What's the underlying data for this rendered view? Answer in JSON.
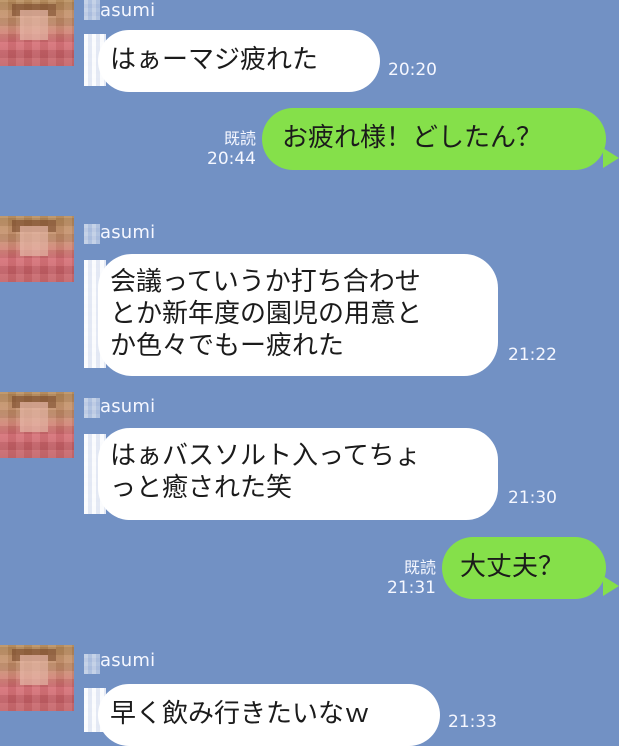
{
  "chat": {
    "messages": [
      {
        "type": "incoming",
        "sender": "asumi",
        "text": "はぁーマジ疲れた",
        "time": "20:20"
      },
      {
        "type": "outgoing",
        "read": "既読",
        "time": "20:44",
        "text": "お疲れ様！どしたん？"
      },
      {
        "type": "incoming",
        "sender": "asumi",
        "text": "会議っていうか打ち合わせ\nとか新年度の園児の用意と\nか色々でもー疲れた",
        "time": "21:22"
      },
      {
        "type": "incoming",
        "sender": "asumi",
        "text": "はぁバスソルト入ってちょ\nっと癒された笑",
        "time": "21:30"
      },
      {
        "type": "outgoing",
        "read": "既読",
        "time": "21:31",
        "text": "大丈夫？"
      },
      {
        "type": "incoming",
        "sender": "asumi",
        "text": "早く飲み行きたいなｗ",
        "time": "21:33"
      }
    ]
  },
  "colors": {
    "background": "#7291c4",
    "incoming_bubble": "#ffffff",
    "outgoing_bubble": "#85e04a"
  }
}
